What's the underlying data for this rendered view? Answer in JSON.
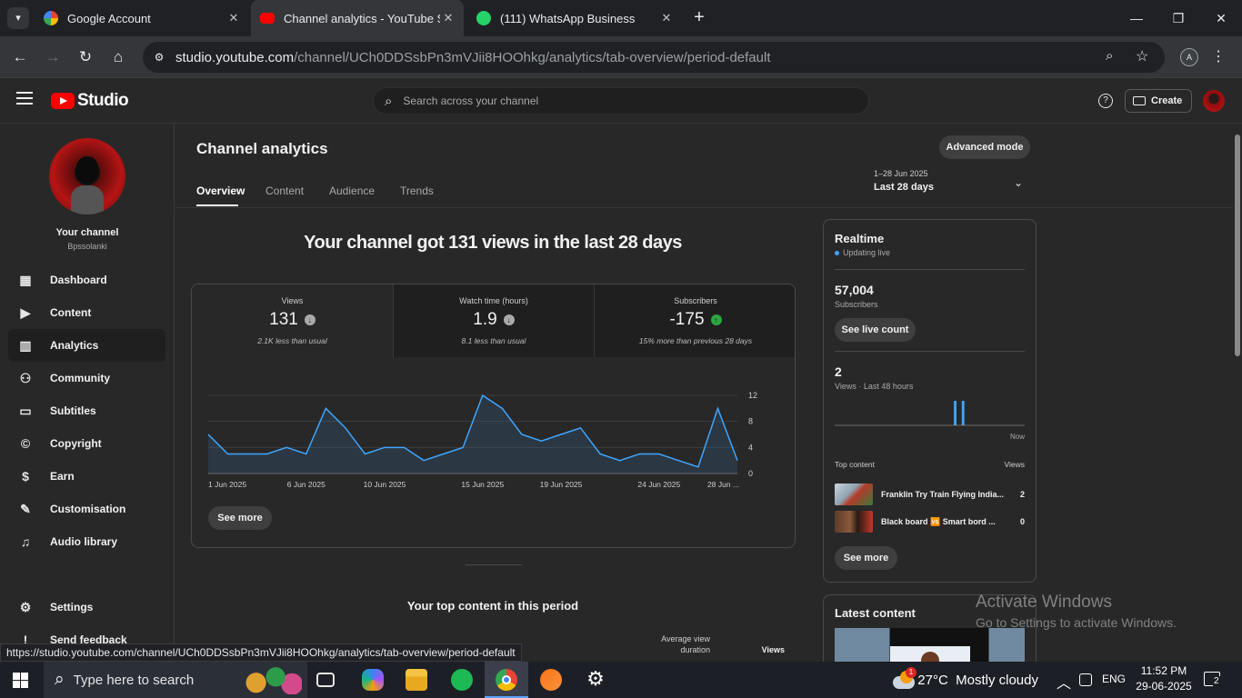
{
  "browser": {
    "tabs": [
      {
        "title": "Google Account",
        "color": "#4285f4"
      },
      {
        "title": "Channel analytics - YouTube Stu",
        "color": "#ff0000"
      },
      {
        "title": "(111) WhatsApp Business",
        "color": "#25d366"
      }
    ],
    "url_host": "studio.youtube.com",
    "url_path": "/channel/UCh0DDSsbPn3mVJii8HOOhkg/analytics/tab-overview/period-default",
    "status_url": "https://studio.youtube.com/channel/UCh0DDSsbPn3mVJii8HOOhkg/analytics/tab-overview/period-default"
  },
  "header": {
    "logo_text": "Studio",
    "search_placeholder": "Search across your channel",
    "create_label": "Create"
  },
  "sidebar": {
    "channel_title": "Your channel",
    "channel_name": "Bpssolanki",
    "items": [
      {
        "label": "Dashboard",
        "icon": "dashboard-icon"
      },
      {
        "label": "Content",
        "icon": "content-icon"
      },
      {
        "label": "Analytics",
        "icon": "analytics-icon"
      },
      {
        "label": "Community",
        "icon": "community-icon"
      },
      {
        "label": "Subtitles",
        "icon": "subtitles-icon"
      },
      {
        "label": "Copyright",
        "icon": "copyright-icon"
      },
      {
        "label": "Earn",
        "icon": "earn-icon"
      },
      {
        "label": "Customisation",
        "icon": "customisation-icon"
      },
      {
        "label": "Audio library",
        "icon": "audio-library-icon"
      }
    ],
    "settings_label": "Settings",
    "feedback_label": "Send feedback"
  },
  "page": {
    "title": "Channel analytics",
    "advanced_mode": "Advanced mode",
    "tabs": [
      "Overview",
      "Content",
      "Audience",
      "Trends"
    ],
    "period_range": "1–28 Jun 2025",
    "period_label": "Last 28 days",
    "headline": "Your channel got 131 views in the last 28 days",
    "metrics": [
      {
        "label": "Views",
        "value": "131",
        "note": "2.1K less than usual",
        "trend": "down"
      },
      {
        "label": "Watch time (hours)",
        "value": "1.9",
        "note": "8.1 less than usual",
        "trend": "down"
      },
      {
        "label": "Subscribers",
        "value": "-175",
        "note": "15% more than previous 28 days",
        "trend": "up"
      }
    ],
    "see_more": "See more",
    "top_content_title": "Your top content in this period",
    "col_avg_view_duration": "Average view duration",
    "col_views": "Views"
  },
  "realtime": {
    "title": "Realtime",
    "updating": "Updating live",
    "subscribers_value": "57,004",
    "subscribers_label": "Subscribers",
    "see_live_count": "See live count",
    "views_value": "2",
    "views_label": "Views · Last 48 hours",
    "now_label": "Now",
    "top_content_label": "Top content",
    "views_col": "Views",
    "top_items": [
      {
        "title": "Franklin Try Train Flying India...",
        "views": "2"
      },
      {
        "title": "Black board 🆚 Smart bord ...",
        "views": "0"
      }
    ],
    "see_more": "See more",
    "bar_values": [
      0,
      0,
      0,
      0,
      0,
      0,
      0,
      0,
      0,
      0,
      0,
      0,
      0,
      0,
      0,
      0,
      0,
      0,
      0,
      0,
      0,
      0,
      0,
      0,
      0,
      0,
      0,
      0,
      0,
      0,
      1,
      0,
      1,
      0,
      0,
      0,
      0,
      0,
      0,
      0,
      0,
      0,
      0,
      0,
      0,
      0,
      0,
      0
    ]
  },
  "latest_content": {
    "title": "Latest content"
  },
  "watermark": {
    "line1": "Activate Windows",
    "line2": "Go to Settings to activate Windows."
  },
  "taskbar": {
    "search_placeholder": "Type here to search",
    "weather": "27°C  Mostly cloudy",
    "lang": "ENG",
    "time": "11:52 PM",
    "date": "29-06-2025",
    "notification_count": "2",
    "weather_badge": "1"
  },
  "chart_data": {
    "type": "area",
    "x": [
      "1 Jun",
      "2 Jun",
      "3 Jun",
      "4 Jun",
      "5 Jun",
      "6 Jun",
      "7 Jun",
      "8 Jun",
      "9 Jun",
      "10 Jun",
      "11 Jun",
      "12 Jun",
      "13 Jun",
      "14 Jun",
      "15 Jun",
      "16 Jun",
      "17 Jun",
      "18 Jun",
      "19 Jun",
      "20 Jun",
      "21 Jun",
      "22 Jun",
      "23 Jun",
      "24 Jun",
      "25 Jun",
      "26 Jun",
      "27 Jun",
      "28 Jun"
    ],
    "values": [
      6,
      3,
      3,
      3,
      4,
      3,
      10,
      7,
      3,
      4,
      4,
      2,
      3,
      4,
      12,
      10,
      6,
      5,
      6,
      7,
      3,
      2,
      3,
      3,
      2,
      1,
      10,
      2
    ],
    "tick_labels": [
      "1 Jun 2025",
      "6 Jun 2025",
      "10 Jun 2025",
      "15 Jun 2025",
      "19 Jun 2025",
      "24 Jun 2025",
      "28 Jun ..."
    ],
    "tick_index": [
      0,
      5,
      9,
      14,
      18,
      23,
      27
    ],
    "y_ticks": [
      "0",
      "4",
      "8",
      "12"
    ],
    "ylim": [
      0,
      12
    ],
    "grid": true,
    "line_color": "#3ea6ff"
  }
}
